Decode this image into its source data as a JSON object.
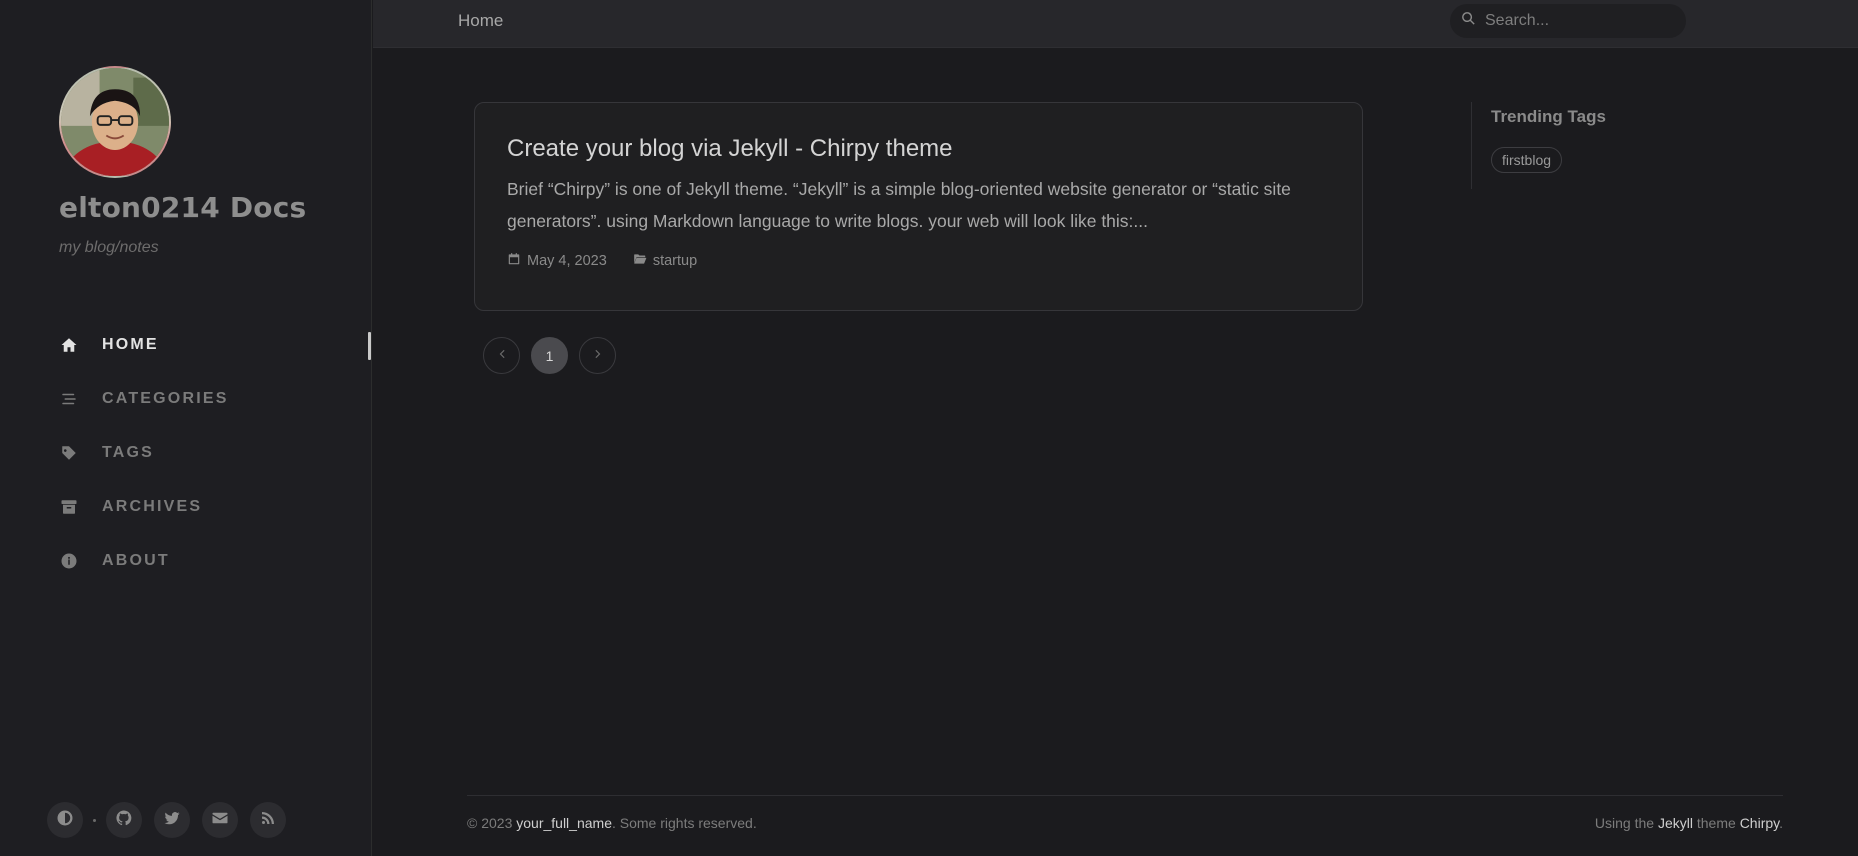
{
  "sidebar": {
    "title": "elton0214 Docs",
    "subtitle": "my blog/notes",
    "nav": [
      {
        "label": "HOME",
        "icon": "home-icon",
        "active": true
      },
      {
        "label": "CATEGORIES",
        "icon": "stream-icon",
        "active": false
      },
      {
        "label": "TAGS",
        "icon": "tag-icon",
        "active": false
      },
      {
        "label": "ARCHIVES",
        "icon": "archive-icon",
        "active": false
      },
      {
        "label": "ABOUT",
        "icon": "info-icon",
        "active": false
      }
    ],
    "bottom_icons": [
      "theme-toggle-icon",
      "github-icon",
      "twitter-icon",
      "email-icon",
      "rss-icon"
    ]
  },
  "topbar": {
    "breadcrumb": "Home",
    "search_placeholder": "Search..."
  },
  "post": {
    "title": "Create your blog via Jekyll - Chirpy theme",
    "excerpt": "Brief “Chirpy” is one of Jekyll theme. “Jekyll” is a simple blog-oriented website generator or “static site generators”. using Markdown language to write blogs. your web will look like this:...",
    "date": "May 4, 2023",
    "category": "startup"
  },
  "pagination": {
    "current": "1"
  },
  "trending": {
    "heading": "Trending Tags",
    "tags": [
      "firstblog"
    ]
  },
  "footer": {
    "copyright_prefix": "© 2023 ",
    "name": "your_full_name",
    "rights": ". Some rights reserved.",
    "using_the": "Using the ",
    "jekyll": "Jekyll",
    "theme_word": " theme ",
    "chirpy": "Chirpy",
    "period": "."
  },
  "colors": {
    "background": "#1b1b1e",
    "sidebar": "#1e1e22",
    "topbar": "#27272b",
    "card": "#1f1f21",
    "active_text": "#e3e3e3"
  }
}
